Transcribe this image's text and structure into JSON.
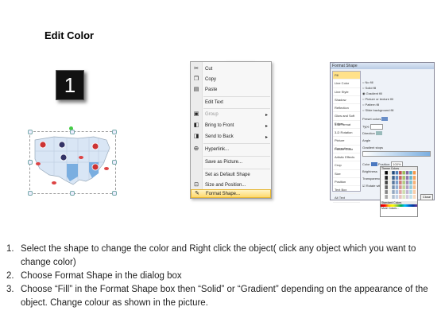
{
  "title": "Edit Color",
  "steps": [
    "1",
    "2",
    "3"
  ],
  "menu": {
    "items": [
      {
        "icon": "scissors-icon",
        "label": "Cut",
        "arrow": ""
      },
      {
        "icon": "copy-icon",
        "label": "Copy",
        "arrow": ""
      },
      {
        "icon": "paste-icon",
        "label": "Paste",
        "arrow": ""
      },
      {
        "icon": "",
        "label": "Edit Text",
        "arrow": ""
      },
      {
        "icon": "group-icon",
        "label": "Group",
        "arrow": "▸"
      },
      {
        "icon": "bring-front-icon",
        "label": "Bring to Front",
        "arrow": "▸"
      },
      {
        "icon": "send-back-icon",
        "label": "Send to Back",
        "arrow": "▸"
      },
      {
        "icon": "hyperlink-icon",
        "label": "Hyperlink...",
        "arrow": ""
      },
      {
        "icon": "",
        "label": "Save as Picture...",
        "arrow": ""
      },
      {
        "icon": "",
        "label": "Set as Default Shape",
        "arrow": ""
      },
      {
        "icon": "size-icon",
        "label": "Size and Position...",
        "arrow": ""
      },
      {
        "icon": "format-shape-icon",
        "label": "Format Shape...",
        "arrow": ""
      }
    ]
  },
  "dialog": {
    "title": "Format Shape",
    "categories": [
      "Fill",
      "Line Color",
      "Line Style",
      "Shadow",
      "Reflection",
      "Glow and Soft Edges",
      "3-D Format",
      "3-D Rotation",
      "Picture Corrections",
      "Picture Color",
      "Artistic Effects",
      "Crop",
      "Size",
      "Position",
      "Text Box",
      "Alt Text"
    ],
    "fill_options": [
      "No fill",
      "Solid fill",
      "Gradient fill",
      "Picture or texture fill",
      "Pattern fill",
      "Slide background fill"
    ],
    "fields": [
      "Preset colors",
      "Type",
      "Direction",
      "Angle",
      "Gradient stops",
      "Color",
      "Brightness",
      "Transparency"
    ],
    "position_label": "Position:",
    "position_value": "100%",
    "palette_title": "Theme Colors",
    "palette_standard": "Standard Colors",
    "palette_more": "More Colors...",
    "close": "Close",
    "rotate_label": "Rotate with shape"
  },
  "instructions": [
    {
      "num": "1.",
      "text": "Select the shape to change the color and Right click the object( click any object which you want to change color)"
    },
    {
      "num": "2.",
      "text": "Choose Format Shape in the dialog box"
    },
    {
      "num": "3.",
      "text": "Choose “Fill” in the Format Shape box then “Solid” or “Gradient” depending on the appearance of the object. Change colour as shown in the picture."
    }
  ],
  "colors": {
    "step_box": "#111111",
    "menu_highlight": "#ffd86b",
    "map_fill": "#d9e6f5",
    "map_state_blue": "#7aaee0"
  }
}
